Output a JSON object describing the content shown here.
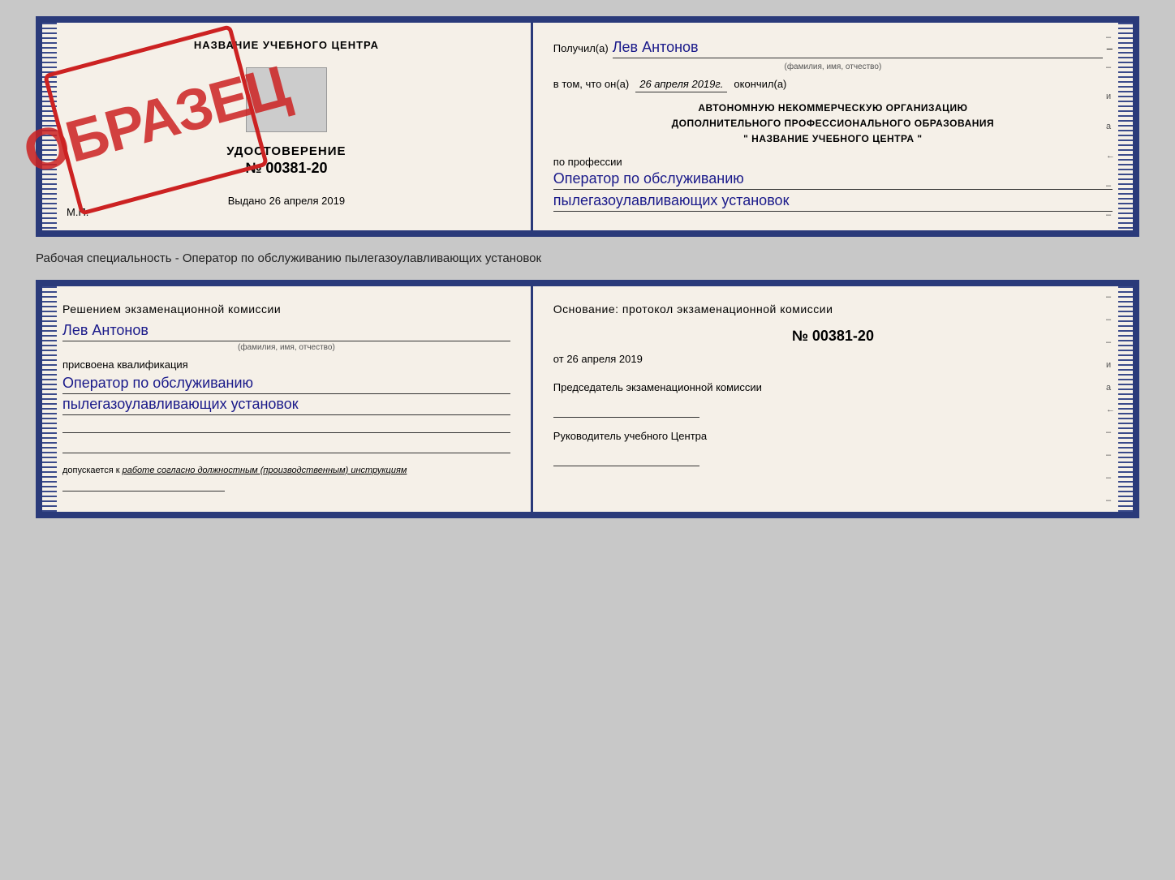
{
  "page": {
    "background": "#c8c8c8"
  },
  "certificate": {
    "left": {
      "title": "НАЗВАНИЕ УЧЕБНОГО ЦЕНТРА",
      "udostoverenie": "УДОСТОВЕРЕНИЕ",
      "number": "№ 00381-20",
      "vydano_label": "Выдано",
      "vydano_date": "26 апреля 2019",
      "mp": "М.П.",
      "stamp": "ОБРАЗЕЦ"
    },
    "right": {
      "received_label": "Получил(а)",
      "received_name": "Лев Антонов",
      "fio_label": "(фамилия, имя, отчество)",
      "vtom_label": "в том, что он(а)",
      "vtom_date": "26 апреля 2019г.",
      "okonchil": "окончил(а)",
      "org_line1": "АВТОНОМНУЮ НЕКОММЕРЧЕСКУЮ ОРГАНИЗАЦИЮ",
      "org_line2": "ДОПОЛНИТЕЛЬНОГО ПРОФЕССИОНАЛЬНОГО ОБРАЗОВАНИЯ",
      "org_line3": "\"   НАЗВАНИЕ УЧЕБНОГО ЦЕНТРА   \"",
      "po_professii": "по профессии",
      "profession_line1": "Оператор по обслуживанию",
      "profession_line2": "пылегазоулавливающих установок"
    }
  },
  "between": {
    "text": "Рабочая специальность - Оператор по обслуживанию пылегазоулавливающих установок"
  },
  "qualification": {
    "left": {
      "decision_text": "Решением экзаменационной комиссии",
      "name": "Лев Антонов",
      "fio_label": "(фамилия, имя, отчество)",
      "prisvoena": "присвоена квалификация",
      "qual_line1": "Оператор по обслуживанию",
      "qual_line2": "пылегазоулавливающих установок",
      "dopusk_label": "допускается к",
      "dopusk_text": "работе согласно должностным (производственным) инструкциям"
    },
    "right": {
      "osnov_text": "Основание: протокол экзаменационной комиссии",
      "protocol_number": "№ 00381-20",
      "ot_prefix": "от",
      "ot_date": "26 апреля 2019",
      "predsedatel_label": "Председатель экзаменационной комиссии",
      "rukovoditel_label": "Руководитель учебного Центра"
    }
  },
  "side_markers": {
    "items": [
      "–",
      "–",
      "–",
      "и",
      "а",
      "←",
      "–",
      "–",
      "–",
      "–"
    ]
  }
}
